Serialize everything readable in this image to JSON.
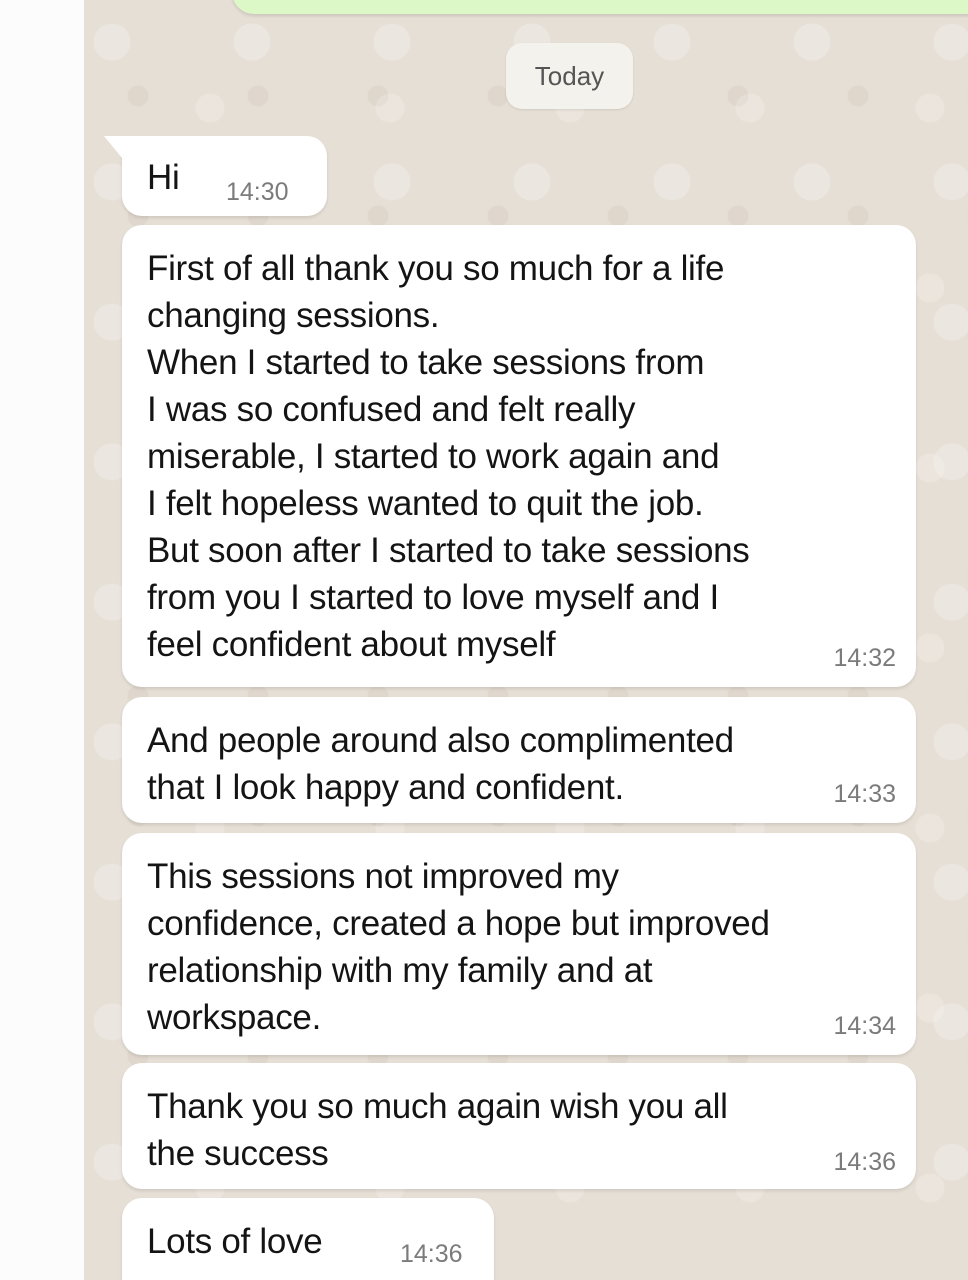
{
  "date_chip": "Today",
  "messages": [
    {
      "text": "Hi",
      "time": "14:30"
    },
    {
      "text": "First of all thank you so much for a life\nchanging sessions.\nWhen I started to take sessions from\nI was so confused and felt really\nmiserable, I started to work again and\nI felt hopeless wanted to quit the job.\nBut soon after I started to take sessions\nfrom you I started to love myself and I\nfeel confident about myself",
      "time": "14:32"
    },
    {
      "text": "And people around also complimented\nthat I look happy and confident.",
      "time": "14:33"
    },
    {
      "text": "This sessions not improved my\nconfidence, created a hope but improved\nrelationship with my family and at\nworkspace.",
      "time": "14:34"
    },
    {
      "text": "Thank you so much again wish you all\nthe success",
      "time": "14:36"
    },
    {
      "text": "Lots of love",
      "time": "14:36"
    }
  ],
  "colors": {
    "chat_background": "#e6dfd6",
    "incoming_bubble": "#ffffff",
    "outgoing_bubble": "#dcf8c6",
    "timestamp": "#7b7b7b"
  }
}
